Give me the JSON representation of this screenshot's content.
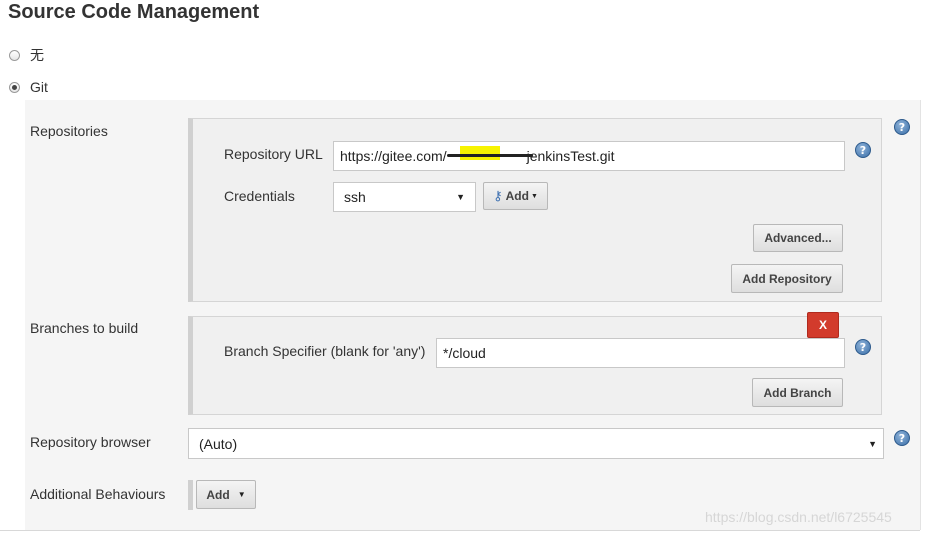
{
  "header": {
    "title": "Source Code Management"
  },
  "scm_options": [
    {
      "label": "无",
      "checked": false
    },
    {
      "label": "Git",
      "checked": true
    }
  ],
  "repositories": {
    "label": "Repositories",
    "url_label": "Repository URL",
    "url_value": "https://gitee.com/",
    "url_value_tail": "jenkinsTest.git",
    "credentials_label": "Credentials",
    "credentials_selected": "ssh",
    "add_credentials_label": "Add",
    "advanced_label": "Advanced...",
    "add_repository_label": "Add Repository"
  },
  "branches": {
    "label": "Branches to build",
    "delete_label": "X",
    "specifier_label": "Branch Specifier (blank for 'any')",
    "specifier_value": "*/cloud",
    "add_branch_label": "Add Branch"
  },
  "repository_browser": {
    "label": "Repository browser",
    "selected": "(Auto)"
  },
  "additional_behaviours": {
    "label": "Additional Behaviours",
    "add_label": "Add"
  },
  "help_icon_text": "?",
  "watermark": "https://blog.csdn.net/l6725545",
  "colors": {
    "delete_button": "#d23b2c",
    "help_icon": "#3b6fa8",
    "panel_bg": "#f0f0f0"
  }
}
